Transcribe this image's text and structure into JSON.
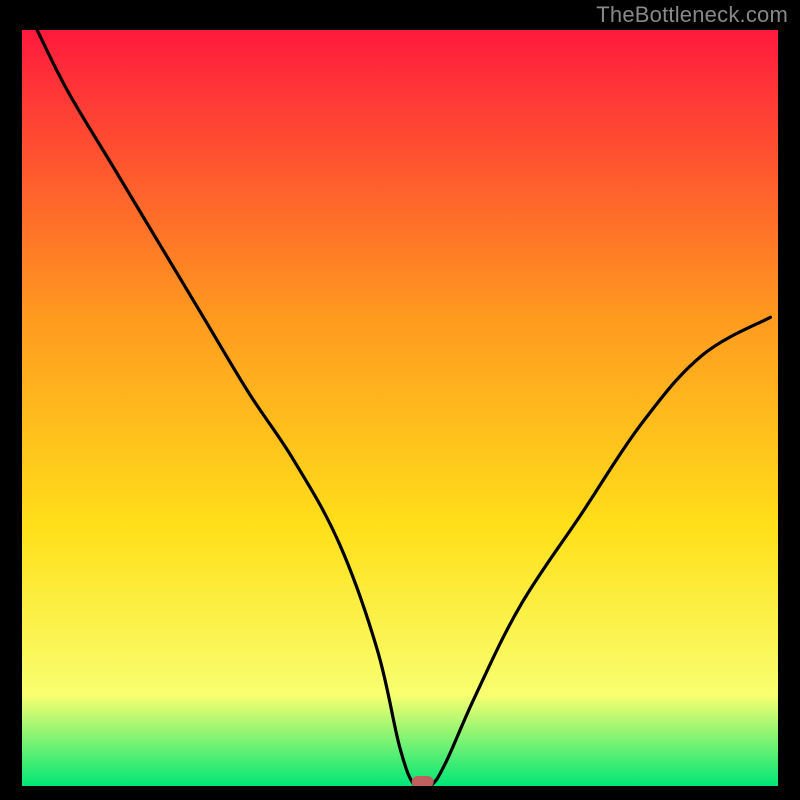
{
  "watermark": "TheBottleneck.com",
  "chart_data": {
    "type": "line",
    "title": "",
    "xlabel": "",
    "ylabel": "",
    "xlim": [
      0,
      100
    ],
    "ylim": [
      0,
      100
    ],
    "grid": false,
    "background_gradient": {
      "top": "#ff1a3d",
      "mid_upper": "#ff9a1f",
      "mid": "#ffe01a",
      "mid_lower": "#f8ff70",
      "bottom": "#00e676"
    },
    "series": [
      {
        "name": "bottleneck-curve",
        "x": [
          2,
          6,
          12,
          18,
          24,
          30,
          36,
          42,
          47,
          50,
          52,
          54,
          56,
          60,
          66,
          74,
          82,
          90,
          99
        ],
        "values": [
          100,
          92,
          82,
          72,
          62,
          52,
          43,
          32,
          18,
          5,
          0,
          0,
          3,
          12,
          24,
          36,
          48,
          57,
          62
        ]
      }
    ],
    "marker": {
      "x": 53,
      "y": 0,
      "color": "#c0605e"
    }
  }
}
